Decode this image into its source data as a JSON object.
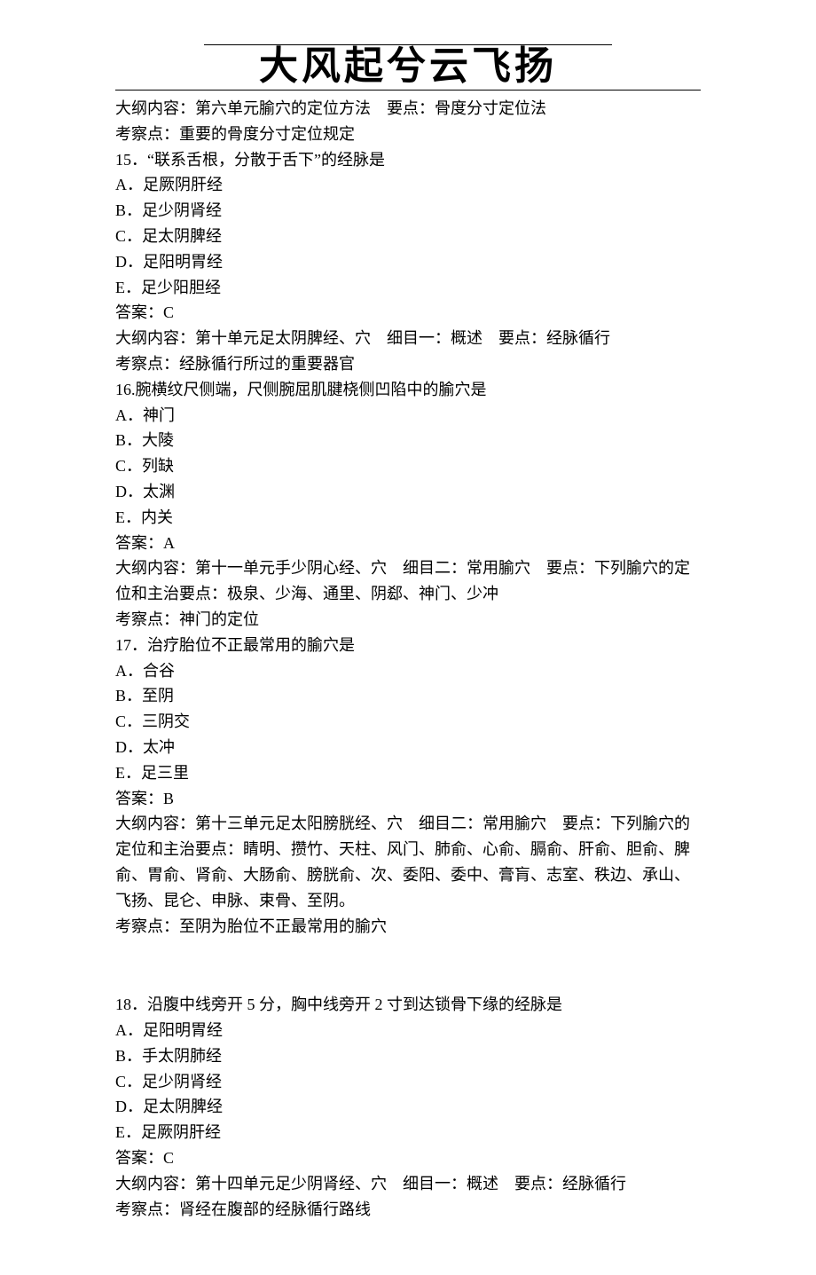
{
  "header": {
    "calligraphy": "大风起兮云飞扬"
  },
  "q14": {
    "outline": "大纲内容：第六单元腧穴的定位方法　要点：骨度分寸定位法",
    "exam": "考察点：重要的骨度分寸定位规定"
  },
  "q15": {
    "stem": "15．“联系舌根，分散于舌下”的经脉是",
    "optA": "A．足厥阴肝经",
    "optB": "B．足少阴肾经",
    "optC": "C．足太阴脾经",
    "optD": "D．足阳明胃经",
    "optE": "E．足少阳胆经",
    "answer": "答案：C",
    "outline": "大纲内容：第十单元足太阴脾经、穴　细目一：概述　要点：经脉循行",
    "exam": "考察点：经脉循行所过的重要器官"
  },
  "q16": {
    "stem": "16.腕横纹尺侧端，尺侧腕屈肌腱桡侧凹陷中的腧穴是",
    "optA": "A．神门",
    "optB": "B．大陵",
    "optC": "C．列缺",
    "optD": "D．太渊",
    "optE": "E．内关",
    "answer": "答案：A",
    "outline": "大纲内容：第十一单元手少阴心经、穴　细目二：常用腧穴　要点：下列腧穴的定位和主治要点：极泉、少海、通里、阴郄、神门、少冲",
    "exam": "考察点：神门的定位"
  },
  "q17": {
    "stem": "17．治疗胎位不正最常用的腧穴是",
    "optA": "A．合谷",
    "optB": "B．至阴",
    "optC": "C．三阴交",
    "optD": "D．太冲",
    "optE": "E．足三里",
    "answer": "答案：B",
    "outline": "大纲内容：第十三单元足太阳膀胱经、穴　细目二：常用腧穴　要点：下列腧穴的定位和主治要点：睛明、攒竹、天柱、风门、肺俞、心俞、膈俞、肝俞、胆俞、脾俞、胃俞、肾俞、大肠俞、膀胱俞、次、委阳、委中、膏肓、志室、秩边、承山、飞扬、昆仑、申脉、束骨、至阴。",
    "exam": "考察点：至阴为胎位不正最常用的腧穴"
  },
  "q18": {
    "stem": "18．沿腹中线旁开 5 分，胸中线旁开 2 寸到达锁骨下缘的经脉是",
    "optA": "A．足阳明胃经",
    "optB": "B．手太阴肺经",
    "optC": "C．足少阴肾经",
    "optD": "D．足太阴脾经",
    "optE": "E．足厥阴肝经",
    "answer": "答案：C",
    "outline": "大纲内容：第十四单元足少阴肾经、穴　细目一：概述　要点：经脉循行",
    "exam": "考察点：肾经在腹部的经脉循行路线"
  }
}
